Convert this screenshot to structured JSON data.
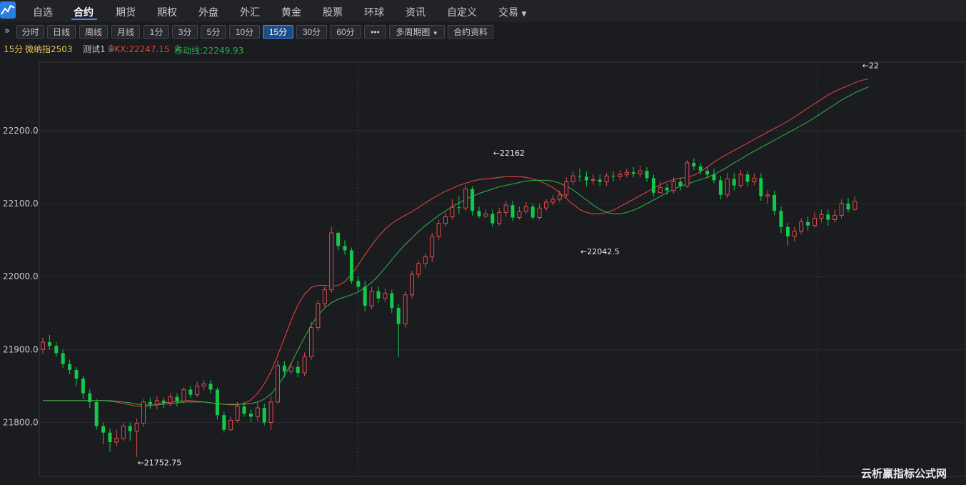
{
  "nav": {
    "items": [
      "自选",
      "合约",
      "期货",
      "期权",
      "外盘",
      "外汇",
      "黄金",
      "股票",
      "环球",
      "资讯",
      "自定义",
      "交易"
    ],
    "active_index": 1
  },
  "toolbar": {
    "expand_icon": "»",
    "buttons": [
      "分时",
      "日线",
      "周线",
      "月线",
      "1分",
      "3分",
      "5分",
      "10分",
      "15分",
      "30分",
      "60分",
      "•••",
      "多周期图",
      "合约资料"
    ],
    "active": "15分",
    "dropdown_buttons": [
      "多周期图"
    ]
  },
  "info": {
    "period": "15分",
    "symbol": "微纳指2503",
    "indicator_name": "测试1",
    "dkx_label": "DKX:22247.15",
    "dkx_arrow": "↓",
    "ma_label": "移动线:22249.93",
    "ma_arrow": "↓"
  },
  "colors": {
    "up": "#e04b4b",
    "down": "#12c94a",
    "dkx": "#e0403a",
    "ma": "#2fa84a",
    "grid": "#2a2b30",
    "axis_text": "#c8c8c8",
    "accent": "#3b8cff"
  },
  "watermark": "云析赢指标公式网",
  "chart_data": {
    "type": "candlestick",
    "ylim": [
      21726,
      22294
    ],
    "y_ticks": [
      "21800.0",
      "21900.0",
      "22000.0",
      "22100.0",
      "22200.0"
    ],
    "grid": true,
    "annotations": [
      {
        "text": "←21752.75",
        "index": 14,
        "value": 21752.75,
        "position": "below"
      },
      {
        "text": "←22042.5",
        "index": 80,
        "value": 22042.5,
        "position": "below"
      },
      {
        "text": "←22162",
        "index": 67,
        "value": 22162,
        "position": "above"
      },
      {
        "text": "←22",
        "index": 122,
        "value": 22282,
        "position": "above"
      }
    ],
    "series": [
      {
        "name": "DKX",
        "values": [
          21830,
          21830,
          21830,
          21830,
          21830,
          21830,
          21830,
          21830,
          21830,
          21830,
          21829,
          21828,
          21826,
          21824,
          21822,
          21821,
          21823,
          21825,
          21827,
          21828,
          21829,
          21830,
          21830,
          21829,
          21828,
          21827,
          21826,
          21825,
          21824,
          21824,
          21826,
          21831,
          21840,
          21853,
          21870,
          21892,
          21916,
          21940,
          21961,
          21976,
          21985,
          21988,
          21988,
          21987,
          21988,
          21993,
          22003,
          22016,
          22030,
          22043,
          22055,
          22065,
          22073,
          22079,
          22084,
          22089,
          22095,
          22101,
          22107,
          22112,
          22117,
          22121,
          22125,
          22128,
          22131,
          22133,
          22134,
          22135,
          22136,
          22137,
          22137,
          22137,
          22136,
          22134,
          22131,
          22127,
          22122,
          22115,
          22107,
          22099,
          22092,
          22088,
          22086,
          22086,
          22088,
          22091,
          22096,
          22101,
          22106,
          22111,
          22116,
          22121,
          22126,
          22130,
          22133,
          22135,
          22136,
          22139,
          22144,
          22150,
          22157,
          22163,
          22168,
          22173,
          22178,
          22183,
          22188,
          22193,
          22198,
          22203,
          22208,
          22213,
          22219,
          22225,
          22231,
          22237,
          22243,
          22249,
          22254,
          22258,
          22262,
          22266,
          22269,
          22271
        ]
      },
      {
        "name": "移动线",
        "values": [
          21830,
          21830,
          21830,
          21830,
          21830,
          21830,
          21830,
          21830,
          21830,
          21830,
          21830,
          21829,
          21828,
          21827,
          21825,
          21824,
          21824,
          21824,
          21825,
          21826,
          21827,
          21828,
          21828,
          21828,
          21828,
          21827,
          21826,
          21825,
          21825,
          21825,
          21825,
          21826,
          21828,
          21832,
          21839,
          21850,
          21864,
          21881,
          21899,
          21917,
          21933,
          21947,
          21957,
          21964,
          21969,
          21972,
          21975,
          21979,
          21985,
          21992,
          22001,
          22012,
          22023,
          22034,
          22044,
          22053,
          22062,
          22070,
          22077,
          22084,
          22090,
          22096,
          22101,
          22106,
          22110,
          22114,
          22117,
          22120,
          22123,
          22125,
          22127,
          22129,
          22131,
          22132,
          22132,
          22132,
          22131,
          22128,
          22124,
          22119,
          22112,
          22105,
          22098,
          22092,
          22088,
          22086,
          22086,
          22088,
          22091,
          22095,
          22100,
          22105,
          22110,
          22115,
          22120,
          22124,
          22127,
          22130,
          22133,
          22136,
          22140,
          22145,
          22150,
          22156,
          22161,
          22167,
          22172,
          22177,
          22182,
          22187,
          22192,
          22197,
          22202,
          22207,
          22212,
          22218,
          22224,
          22230,
          22236,
          22242,
          22247,
          22252,
          22256,
          22260
        ]
      }
    ],
    "candles": [
      [
        21900,
        21910,
        21916,
        21894
      ],
      [
        21910,
        21905,
        21920,
        21900
      ],
      [
        21905,
        21895,
        21910,
        21890
      ],
      [
        21895,
        21880,
        21900,
        21875
      ],
      [
        21880,
        21872,
        21886,
        21866
      ],
      [
        21872,
        21860,
        21876,
        21850
      ],
      [
        21860,
        21840,
        21864,
        21832
      ],
      [
        21840,
        21828,
        21846,
        21820
      ],
      [
        21828,
        21795,
        21832,
        21790
      ],
      [
        21795,
        21786,
        21800,
        21770
      ],
      [
        21786,
        21773,
        21792,
        21760
      ],
      [
        21773,
        21778,
        21790,
        21768
      ],
      [
        21778,
        21795,
        21800,
        21775
      ],
      [
        21795,
        21788,
        21800,
        21775
      ],
      [
        21788,
        21799,
        21806,
        21752.75
      ],
      [
        21799,
        21828,
        21832,
        21794
      ],
      [
        21828,
        21825,
        21834,
        21818
      ],
      [
        21825,
        21830,
        21836,
        21818
      ],
      [
        21830,
        21827,
        21834,
        21820
      ],
      [
        21827,
        21835,
        21840,
        21822
      ],
      [
        21835,
        21829,
        21840,
        21822
      ],
      [
        21829,
        21845,
        21848,
        21826
      ],
      [
        21845,
        21838,
        21850,
        21833
      ],
      [
        21838,
        21850,
        21856,
        21835
      ],
      [
        21850,
        21853,
        21858,
        21844
      ],
      [
        21853,
        21845,
        21858,
        21840
      ],
      [
        21845,
        21810,
        21848,
        21804
      ],
      [
        21810,
        21790,
        21815,
        21786
      ],
      [
        21790,
        21803,
        21808,
        21788
      ],
      [
        21803,
        21822,
        21828,
        21800
      ],
      [
        21822,
        21812,
        21828,
        21808
      ],
      [
        21812,
        21808,
        21818,
        21800
      ],
      [
        21808,
        21820,
        21828,
        21802
      ],
      [
        21820,
        21800,
        21826,
        21796
      ],
      [
        21800,
        21828,
        21836,
        21790
      ],
      [
        21828,
        21878,
        21885,
        21826
      ],
      [
        21878,
        21870,
        21884,
        21862
      ],
      [
        21870,
        21876,
        21882,
        21866
      ],
      [
        21876,
        21868,
        21884,
        21862
      ],
      [
        21868,
        21890,
        21896,
        21864
      ],
      [
        21890,
        21930,
        21938,
        21886
      ],
      [
        21930,
        21963,
        21968,
        21926
      ],
      [
        21963,
        21982,
        21986,
        21958
      ],
      [
        21982,
        22060,
        22068,
        21978
      ],
      [
        22060,
        22042,
        22062,
        22036
      ],
      [
        22042,
        22036,
        22050,
        22030
      ],
      [
        22036,
        21994,
        22040,
        21990
      ],
      [
        21994,
        21986,
        22000,
        21980
      ],
      [
        21986,
        21960,
        21994,
        21952
      ],
      [
        21960,
        21980,
        21986,
        21955
      ],
      [
        21980,
        21970,
        21986,
        21964
      ],
      [
        21970,
        21977,
        21983,
        21965
      ],
      [
        21977,
        21957,
        21982,
        21950
      ],
      [
        21957,
        21935,
        21962,
        21890
      ],
      [
        21935,
        21975,
        21980,
        21930
      ],
      [
        21975,
        22003,
        22008,
        21970
      ],
      [
        22003,
        22018,
        22022,
        21998
      ],
      [
        22018,
        22027,
        22032,
        22012
      ],
      [
        22027,
        22055,
        22060,
        22020
      ],
      [
        22055,
        22073,
        22078,
        22050
      ],
      [
        22073,
        22082,
        22088,
        22068
      ],
      [
        22082,
        22095,
        22106,
        22078
      ],
      [
        22095,
        22094,
        22110,
        22086
      ],
      [
        22094,
        22120,
        22125,
        22090
      ],
      [
        22120,
        22090,
        22124,
        22084
      ],
      [
        22090,
        22083,
        22096,
        22080
      ],
      [
        22083,
        22086,
        22092,
        22080
      ],
      [
        22086,
        22073,
        22092,
        22068
      ],
      [
        22073,
        22088,
        22094,
        22070
      ],
      [
        22088,
        22098,
        22104,
        22082
      ],
      [
        22098,
        22081,
        22104,
        22076
      ],
      [
        22081,
        22089,
        22096,
        22078
      ],
      [
        22089,
        22096,
        22102,
        22086
      ],
      [
        22096,
        22081,
        22100,
        22078
      ],
      [
        22081,
        22094,
        22100,
        22078
      ],
      [
        22094,
        22102,
        22106,
        22090
      ],
      [
        22102,
        22106,
        22112,
        22098
      ],
      [
        22106,
        22112,
        22118,
        22102
      ],
      [
        22112,
        22130,
        22136,
        22108
      ],
      [
        22130,
        22138,
        22144,
        22125
      ],
      [
        22138,
        22137,
        22148,
        22130
      ],
      [
        22137,
        22132,
        22144,
        22124
      ],
      [
        22132,
        22133,
        22140,
        22126
      ],
      [
        22133,
        22130,
        22140,
        22124
      ],
      [
        22130,
        22138,
        22142,
        22124
      ],
      [
        22138,
        22137,
        22144,
        22130
      ],
      [
        22137,
        22140,
        22146,
        22132
      ],
      [
        22140,
        22143,
        22148,
        22136
      ],
      [
        22143,
        22141,
        22150,
        22136
      ],
      [
        22141,
        22145,
        22152,
        22136
      ],
      [
        22145,
        22135,
        22150,
        22130
      ],
      [
        22135,
        22115,
        22140,
        22110
      ],
      [
        22115,
        22122,
        22130,
        22115
      ],
      [
        22122,
        22118,
        22128,
        22112
      ],
      [
        22118,
        22130,
        22136,
        22114
      ],
      [
        22130,
        22124,
        22136,
        22118
      ],
      [
        22124,
        22156,
        22160,
        22122
      ],
      [
        22156,
        22151,
        22162,
        22146
      ],
      [
        22151,
        22145,
        22156,
        22140
      ],
      [
        22145,
        22140,
        22150,
        22135
      ],
      [
        22140,
        22132,
        22148,
        22128
      ],
      [
        22132,
        22112,
        22138,
        22106
      ],
      [
        22112,
        22134,
        22142,
        22108
      ],
      [
        22134,
        22125,
        22142,
        22118
      ],
      [
        22125,
        22140,
        22146,
        22122
      ],
      [
        22140,
        22130,
        22145,
        22124
      ],
      [
        22130,
        22135,
        22142,
        22125
      ],
      [
        22135,
        22110,
        22142,
        22104
      ],
      [
        22110,
        22112,
        22118,
        22100
      ],
      [
        22112,
        22090,
        22118,
        22084
      ],
      [
        22090,
        22068,
        22096,
        22060
      ],
      [
        22068,
        22055,
        22074,
        22042.5
      ],
      [
        22055,
        22062,
        22068,
        22048
      ],
      [
        22062,
        22075,
        22080,
        22058
      ],
      [
        22075,
        22070,
        22082,
        22063
      ],
      [
        22070,
        22080,
        22088,
        22067
      ],
      [
        22080,
        22085,
        22092,
        22074
      ],
      [
        22085,
        22078,
        22092,
        22070
      ],
      [
        22078,
        22084,
        22092,
        22074
      ],
      [
        22084,
        22100,
        22106,
        22080
      ],
      [
        22100,
        22092,
        22108,
        22088
      ],
      [
        22092,
        22103,
        22110,
        22090
      ]
    ]
  }
}
